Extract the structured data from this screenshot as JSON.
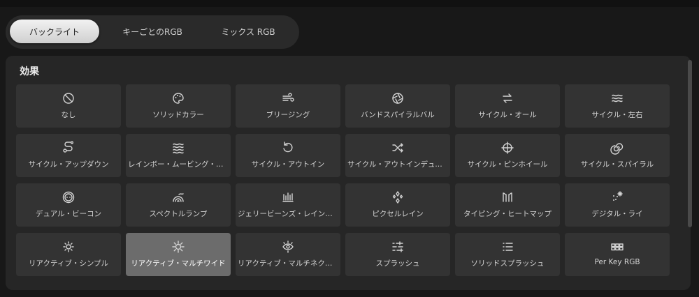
{
  "tabs": [
    {
      "label": "バックライト",
      "active": true
    },
    {
      "label": "キーごとのRGB",
      "active": false
    },
    {
      "label": "ミックス RGB",
      "active": false
    }
  ],
  "section": {
    "title": "効果"
  },
  "effects": [
    {
      "label": "なし",
      "icon": "no-entry-icon"
    },
    {
      "label": "ソリッドカラー",
      "icon": "palette-icon"
    },
    {
      "label": "ブリージング",
      "icon": "wind-icon"
    },
    {
      "label": "バンドスパイラルバル",
      "icon": "aperture-icon"
    },
    {
      "label": "サイクル・オール",
      "icon": "cycle-arrows-icon"
    },
    {
      "label": "サイクル・左右",
      "icon": "waves-icon"
    },
    {
      "label": "サイクル・アップダウン",
      "icon": "route-icon"
    },
    {
      "label": "レインボー・ムービング・シ...",
      "icon": "rainbow-waves-icon"
    },
    {
      "label": "サイクル・アウトイン",
      "icon": "rotate-icon"
    },
    {
      "label": "サイクル・アウトインデュアル",
      "icon": "shuffle-icon"
    },
    {
      "label": "サイクル・ピンホイール",
      "icon": "pinwheel-icon"
    },
    {
      "label": "サイクル・スパイラル",
      "icon": "spiral-icon"
    },
    {
      "label": "デュアル・ビーコン",
      "icon": "beacon-icon"
    },
    {
      "label": "スペクトルランプ",
      "icon": "spectrum-icon"
    },
    {
      "label": "ジェリービーンズ・レインド...",
      "icon": "bars-icon"
    },
    {
      "label": "ピクセルレイン",
      "icon": "pixel-rain-icon"
    },
    {
      "label": "タイピング・ヒートマップ",
      "icon": "heatmap-icon"
    },
    {
      "label": "デジタル・ライ",
      "icon": "sparkle-dots-icon"
    },
    {
      "label": "リアクティブ・シンプル",
      "icon": "sun-small-icon"
    },
    {
      "label": "リアクティブ・マルチワイド",
      "icon": "sun-icon",
      "selected": true
    },
    {
      "label": "リアクティブ・マルチネクサス",
      "icon": "eye-sun-icon"
    },
    {
      "label": "スプラッシュ",
      "icon": "splash-lines-icon"
    },
    {
      "label": "ソリッドスプラッシュ",
      "icon": "list-icon"
    },
    {
      "label": "Per Key RGB",
      "icon": "keyboard-grid-icon"
    }
  ],
  "colors": {
    "selected_tile": "#6c6c6c",
    "tile": "#333333",
    "panel": "#262626"
  }
}
